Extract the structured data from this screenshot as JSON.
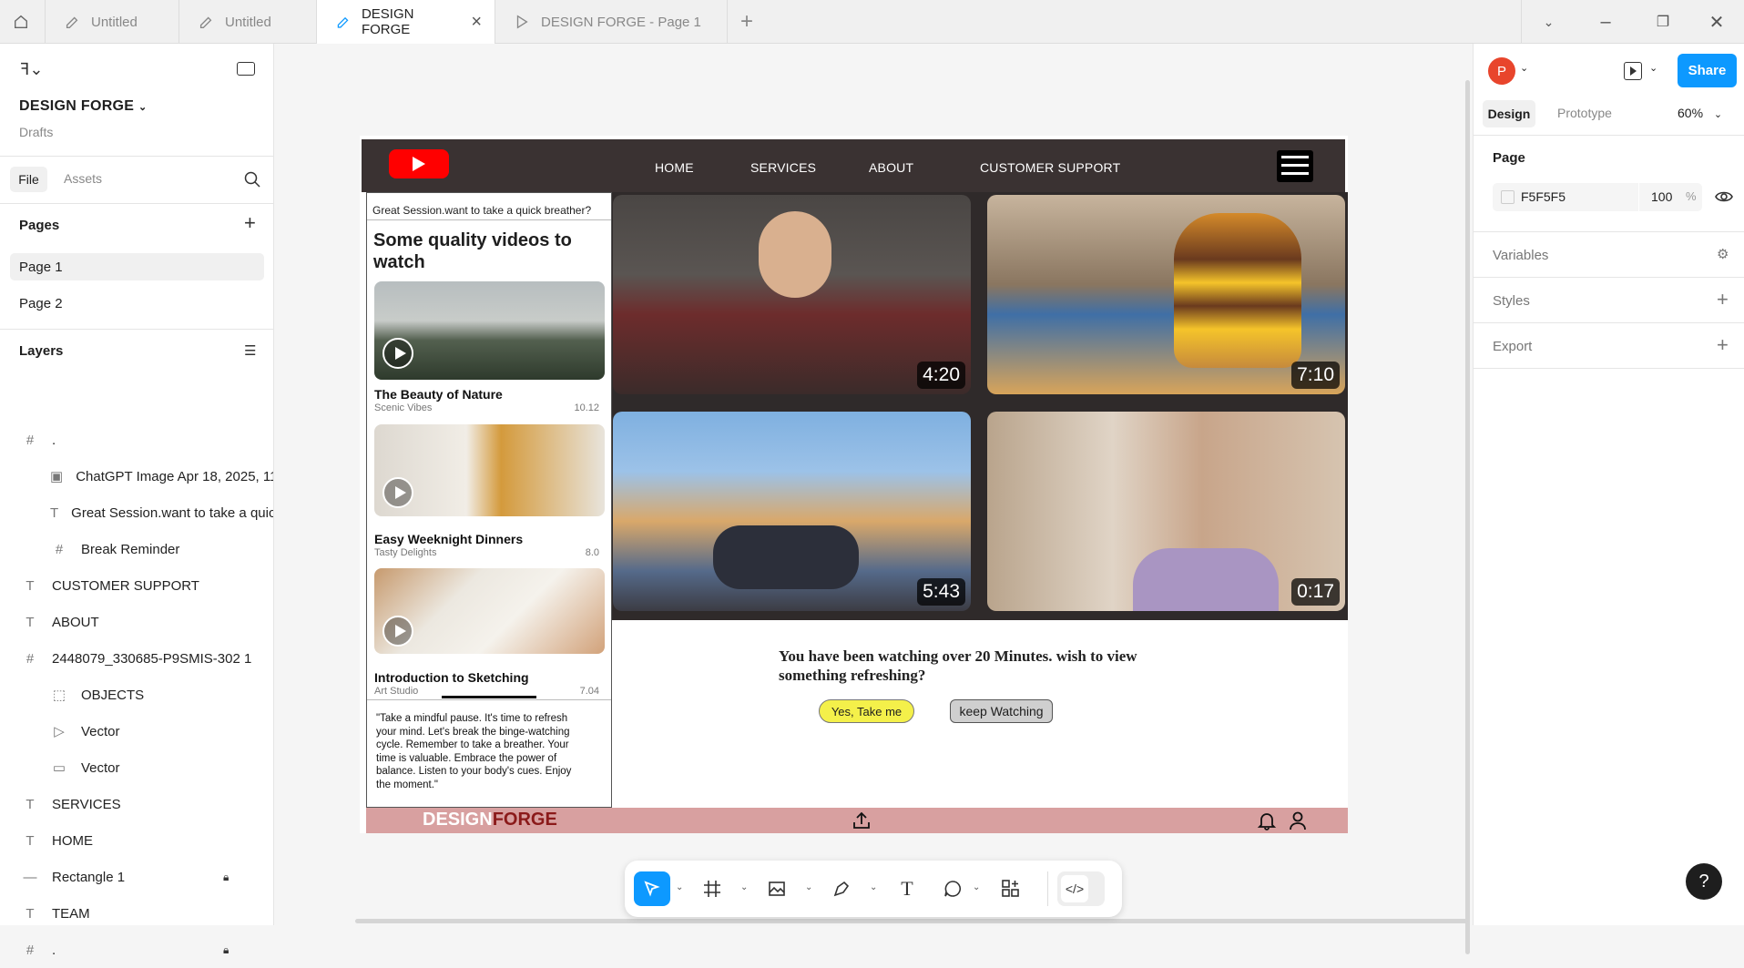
{
  "tabs": [
    {
      "label": "Untitled"
    },
    {
      "label": "Untitled"
    },
    {
      "label": "DESIGN FORGE"
    },
    {
      "label": "DESIGN FORGE - Page 1"
    }
  ],
  "left": {
    "project": "DESIGN FORGE",
    "location": "Drafts",
    "file_tab": "File",
    "assets_tab": "Assets",
    "pages_title": "Pages",
    "pages": [
      "Page 1",
      "Page 2"
    ],
    "layers_title": "Layers",
    "layers": [
      {
        "icon": "frame-icon",
        "label": ".",
        "indent": 0
      },
      {
        "icon": "image-icon",
        "label": "ChatGPT Image Apr 18, 2025, 11_",
        "indent": 1
      },
      {
        "icon": "text-icon",
        "label": "Great Session.want to take a quic",
        "indent": 1
      },
      {
        "icon": "frame-icon",
        "label": "Break Reminder",
        "indent": 1
      },
      {
        "icon": "text-icon",
        "label": "CUSTOMER SUPPORT",
        "indent": 0
      },
      {
        "icon": "text-icon",
        "label": "ABOUT",
        "indent": 0
      },
      {
        "icon": "frame-icon",
        "label": "2448079_330685-P9SMIS-302 1",
        "indent": 0
      },
      {
        "icon": "group-icon",
        "label": "OBJECTS",
        "indent": 1
      },
      {
        "icon": "vector-icon",
        "label": "Vector",
        "indent": 1
      },
      {
        "icon": "rect-icon",
        "label": "Vector",
        "indent": 1
      },
      {
        "icon": "text-icon",
        "label": "SERVICES",
        "indent": 0
      },
      {
        "icon": "text-icon",
        "label": "HOME",
        "indent": 0
      },
      {
        "icon": "line-icon",
        "label": "Rectangle 1",
        "indent": 0,
        "locked": true
      },
      {
        "icon": "text-icon",
        "label": "TEAM",
        "indent": 0
      },
      {
        "icon": "frame-icon",
        "label": ".",
        "indent": 0,
        "locked": true
      }
    ]
  },
  "right": {
    "avatar": "P",
    "share": "Share",
    "design_tab": "Design",
    "prototype_tab": "Prototype",
    "zoom": "60%",
    "page_label": "Page",
    "page_color": "F5F5F5",
    "opacity": "100",
    "opacity_unit": "%",
    "variables": "Variables",
    "styles": "Styles",
    "export": "Export"
  },
  "design": {
    "nav": [
      "HOME",
      "SERVICES",
      "ABOUT",
      "CUSTOMER SUPPORT"
    ],
    "break_title": "Great Session.want to take a quick breather?",
    "heading": "Some quality videos to watch",
    "videos": [
      {
        "title": "The Beauty of Nature",
        "sub": "Scenic Vibes",
        "num": "10.12"
      },
      {
        "title": "Easy Weeknight Dinners",
        "sub": "Tasty Delights",
        "num": "8.0"
      },
      {
        "title": "Introduction to Sketching",
        "sub": "Art Studio",
        "num": "7.04"
      }
    ],
    "quote": "\"Take a mindful pause. It's time to refresh your mind. Let's break the binge-watching cycle. Remember to take a breather. Your time is valuable. Embrace the power of balance. Listen to your body's cues. Enjoy the moment.\"",
    "durations": [
      "4:20",
      "7:10",
      "5:43",
      "0:17"
    ],
    "message": "You have been watching over 20 Minutes. wish to view something refreshing?",
    "yes": "Yes, Take me",
    "keep": "keep Watching",
    "footer_a": "DESIGN",
    "footer_b": "FORGE"
  },
  "colors": {
    "accent": "#0d99ff",
    "youtube": "#ff0000",
    "nav": "#3a3232",
    "footer": "#d8a0a0",
    "yes_btn": "#f4f04a",
    "forge_red": "#8b1a1a"
  }
}
